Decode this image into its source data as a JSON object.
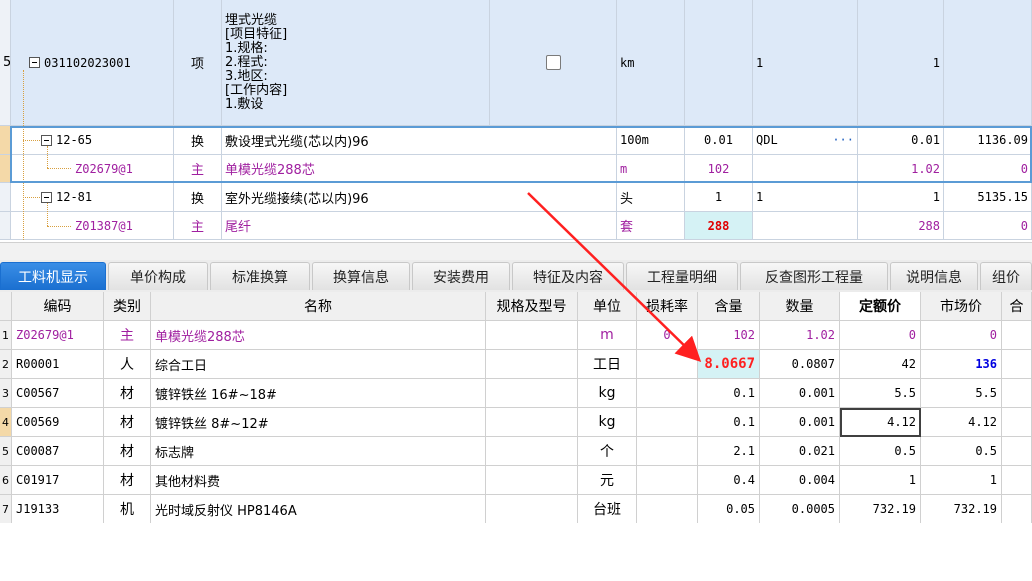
{
  "upper": {
    "main_row": {
      "row_num": "5",
      "code": "031102023001",
      "type": "项",
      "desc_lines": [
        "埋式光缆",
        "[项目特征]",
        "1.规格:",
        "2.程式:",
        "3.地区:",
        "[工作内容]",
        "1.敷设"
      ],
      "unit": "km",
      "col_qdl": "1",
      "qty": "1"
    },
    "rows": [
      {
        "code": "12-65",
        "type": "换",
        "name": "敷设埋式光缆(芯以内)96",
        "unit": "100m",
        "coef": "0.01",
        "qdl": "QDL",
        "more": "···",
        "qty": "0.01",
        "price": "1136.09"
      },
      {
        "code": "Z02679@1",
        "type": "主",
        "name": "单模光缆288芯",
        "unit": "m",
        "coef": "102",
        "qdl": "",
        "more": "",
        "qty": "1.02",
        "price": "0"
      },
      {
        "code": "12-81",
        "type": "换",
        "name": "室外光缆接续(芯以内)96",
        "unit": "头",
        "coef": "1",
        "qdl": "1",
        "more": "",
        "qty": "1",
        "price": "5135.15"
      },
      {
        "code": "Z01387@1",
        "type": "主",
        "name": "尾纤",
        "unit": "套",
        "coef": "288",
        "qdl": "",
        "more": "",
        "qty": "288",
        "price": "0"
      }
    ]
  },
  "tabs": [
    "工料机显示",
    "单价构成",
    "标准换算",
    "换算信息",
    "安装费用",
    "特征及内容",
    "工程量明细",
    "反查图形工程量",
    "说明信息",
    "组价"
  ],
  "lower": {
    "headers": [
      "编码",
      "类别",
      "名称",
      "规格及型号",
      "单位",
      "损耗率",
      "含量",
      "数量",
      "定额价",
      "市场价",
      "合"
    ],
    "rows": [
      {
        "num": "1",
        "code": "Z02679@1",
        "type": "主",
        "name": "单模光缆288芯",
        "spec": "",
        "unit": "m",
        "loss": "0",
        "content": "102",
        "qty": "1.02",
        "quota": "0",
        "market": "0"
      },
      {
        "num": "2",
        "code": "R00001",
        "type": "人",
        "name": "综合工日",
        "spec": "",
        "unit": "工日",
        "loss": "",
        "content": "8.0667",
        "qty": "0.0807",
        "quota": "42",
        "market": "136"
      },
      {
        "num": "3",
        "code": "C00567",
        "type": "材",
        "name": "镀锌铁丝 16#~18#",
        "spec": "",
        "unit": "kg",
        "loss": "",
        "content": "0.1",
        "qty": "0.001",
        "quota": "5.5",
        "market": "5.5"
      },
      {
        "num": "4",
        "code": "C00569",
        "type": "材",
        "name": "镀锌铁丝 8#~12#",
        "spec": "",
        "unit": "kg",
        "loss": "",
        "content": "0.1",
        "qty": "0.001",
        "quota": "4.12",
        "market": "4.12"
      },
      {
        "num": "5",
        "code": "C00087",
        "type": "材",
        "name": "标志牌",
        "spec": "",
        "unit": "个",
        "loss": "",
        "content": "2.1",
        "qty": "0.021",
        "quota": "0.5",
        "market": "0.5"
      },
      {
        "num": "6",
        "code": "C01917",
        "type": "材",
        "name": "其他材料费",
        "spec": "",
        "unit": "元",
        "loss": "",
        "content": "0.4",
        "qty": "0.004",
        "quota": "1",
        "market": "1"
      },
      {
        "num": "7",
        "code": "J19133",
        "type": "机",
        "name": "光时域反射仪 HP8146A",
        "spec": "",
        "unit": "台班",
        "loss": "",
        "content": "0.05",
        "qty": "0.0005",
        "quota": "732.19",
        "market": "732.19"
      }
    ]
  },
  "colors": {
    "accent": "#1a6fd0",
    "arrow": "#ff2020",
    "material": "#a020a0",
    "market_changed": "#0000e0"
  }
}
